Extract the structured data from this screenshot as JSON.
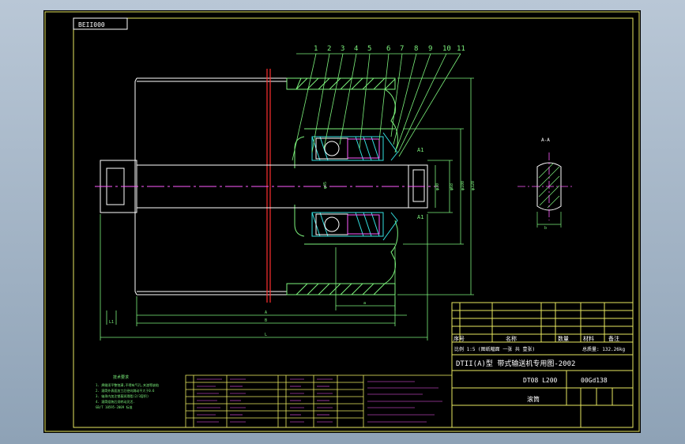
{
  "drawing_code_box": "BEII000",
  "part_numbers": [
    "1",
    "2",
    "3",
    "4",
    "5",
    "6",
    "7",
    "8",
    "9",
    "10",
    "11"
  ],
  "section_label": "A-A",
  "section_markers": [
    "A1",
    "A1"
  ],
  "title_block": {
    "main_title": "DTII(A)型 带式输送机专用图-2002",
    "drawing_number_left": "DT08 L200",
    "drawing_number_right": "00Gd138",
    "part_name": "滚筒",
    "weight_label": "总质量: 132.26kg",
    "scale_row": "比例 1:5  (图纸幅面 一张 共 壹张)",
    "header_cells": [
      "序号",
      "名称",
      "数量",
      "材料",
      "备注"
    ]
  },
  "tech_requirements": {
    "title": "技术要求",
    "lines": [
      "1. 焊缝须平整饱满,不得有气孔,夹渣等缺陷",
      "2. 滚筒外表面加工后径向跳动不大于0.6",
      "3. 轴承内加注锂基润滑脂(2/3容积)",
      "4. 滚筒组装后须转动灵活.",
      "GB/T 10595-2009 标准"
    ]
  },
  "dimensions": {
    "shaft_dia": "φ45",
    "bearing_dia": "φ100",
    "hub_dia": "φ68",
    "outer_dia": "φ320",
    "seat_dia": "φ30",
    "end_dim": "L1",
    "len_total": "L",
    "len_body": "B",
    "len_a": "A",
    "len_small": "a",
    "section_width": "b"
  }
}
